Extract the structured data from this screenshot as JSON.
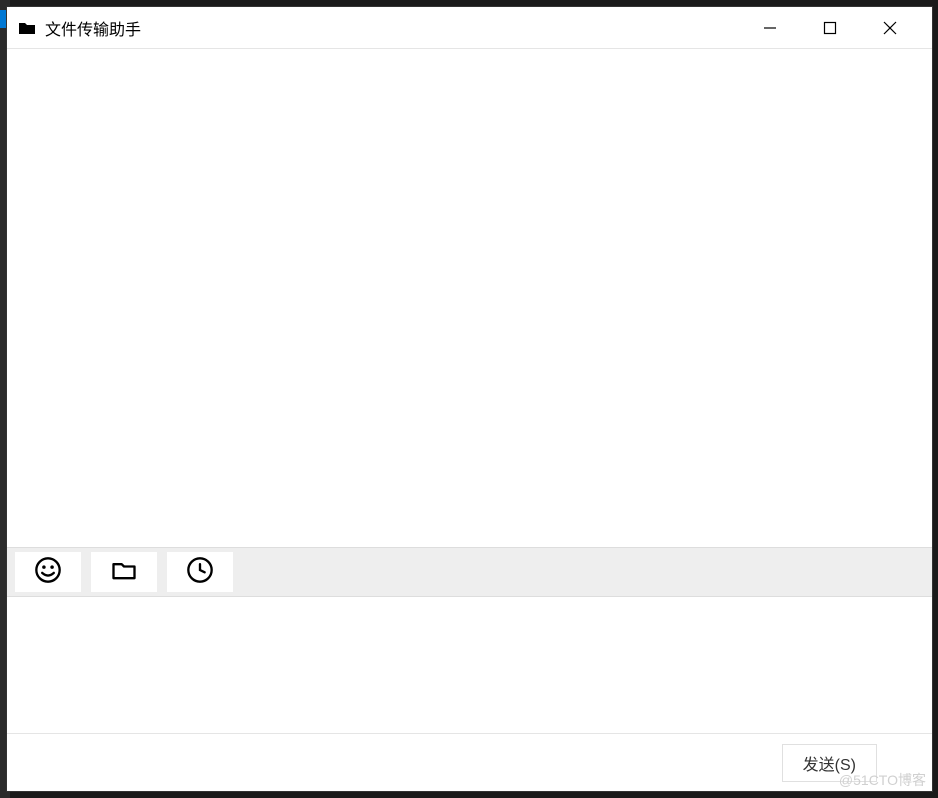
{
  "window": {
    "title": "文件传输助手"
  },
  "toolbar": {
    "emoji": "emoji",
    "folder": "folder",
    "history": "history"
  },
  "input": {
    "value": ""
  },
  "send": {
    "label": "发送(S)"
  },
  "watermark": {
    "text": "@51CTO博客"
  }
}
